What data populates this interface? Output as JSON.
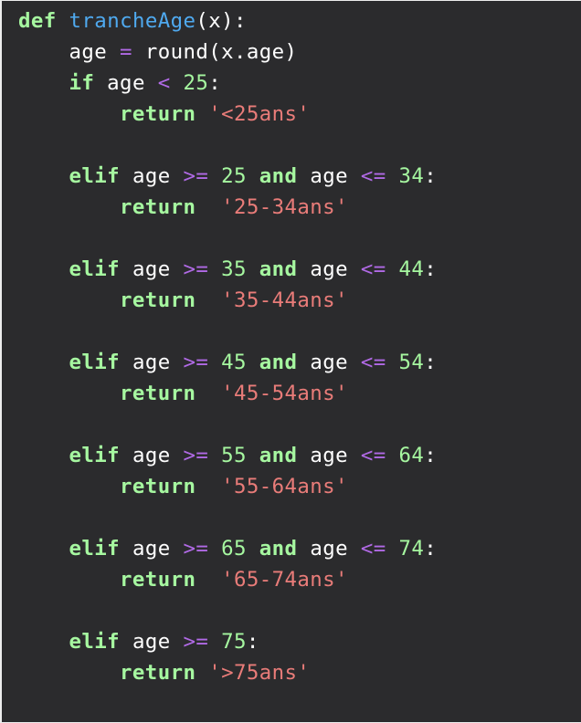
{
  "code": {
    "lines": [
      [
        {
          "text": "def",
          "kind": "kw"
        },
        {
          "text": " ",
          "kind": "txt"
        },
        {
          "text": "trancheAge",
          "kind": "fn"
        },
        {
          "text": "(x):",
          "kind": "txt"
        }
      ],
      [
        {
          "text": "    age ",
          "kind": "txt"
        },
        {
          "text": "=",
          "kind": "op"
        },
        {
          "text": " round(x.age)",
          "kind": "txt"
        }
      ],
      [
        {
          "text": "    ",
          "kind": "txt"
        },
        {
          "text": "if",
          "kind": "kw"
        },
        {
          "text": " age ",
          "kind": "txt"
        },
        {
          "text": "<",
          "kind": "op"
        },
        {
          "text": " ",
          "kind": "txt"
        },
        {
          "text": "25",
          "kind": "num"
        },
        {
          "text": ":",
          "kind": "txt"
        }
      ],
      [
        {
          "text": "        ",
          "kind": "txt"
        },
        {
          "text": "return",
          "kind": "kw"
        },
        {
          "text": " ",
          "kind": "txt"
        },
        {
          "text": "'<25ans'",
          "kind": "str"
        }
      ],
      [
        {
          "text": "",
          "kind": "txt"
        }
      ],
      [
        {
          "text": "    ",
          "kind": "txt"
        },
        {
          "text": "elif",
          "kind": "kw"
        },
        {
          "text": " age ",
          "kind": "txt"
        },
        {
          "text": ">=",
          "kind": "op"
        },
        {
          "text": " ",
          "kind": "txt"
        },
        {
          "text": "25",
          "kind": "num"
        },
        {
          "text": " ",
          "kind": "txt"
        },
        {
          "text": "and",
          "kind": "kw"
        },
        {
          "text": " age ",
          "kind": "txt"
        },
        {
          "text": "<=",
          "kind": "op"
        },
        {
          "text": " ",
          "kind": "txt"
        },
        {
          "text": "34",
          "kind": "num"
        },
        {
          "text": ":",
          "kind": "txt"
        }
      ],
      [
        {
          "text": "        ",
          "kind": "txt"
        },
        {
          "text": "return",
          "kind": "kw"
        },
        {
          "text": "  ",
          "kind": "txt"
        },
        {
          "text": "'25-34ans'",
          "kind": "str"
        }
      ],
      [
        {
          "text": "",
          "kind": "txt"
        }
      ],
      [
        {
          "text": "    ",
          "kind": "txt"
        },
        {
          "text": "elif",
          "kind": "kw"
        },
        {
          "text": " age ",
          "kind": "txt"
        },
        {
          "text": ">=",
          "kind": "op"
        },
        {
          "text": " ",
          "kind": "txt"
        },
        {
          "text": "35",
          "kind": "num"
        },
        {
          "text": " ",
          "kind": "txt"
        },
        {
          "text": "and",
          "kind": "kw"
        },
        {
          "text": " age ",
          "kind": "txt"
        },
        {
          "text": "<=",
          "kind": "op"
        },
        {
          "text": " ",
          "kind": "txt"
        },
        {
          "text": "44",
          "kind": "num"
        },
        {
          "text": ":",
          "kind": "txt"
        }
      ],
      [
        {
          "text": "        ",
          "kind": "txt"
        },
        {
          "text": "return",
          "kind": "kw"
        },
        {
          "text": "  ",
          "kind": "txt"
        },
        {
          "text": "'35-44ans'",
          "kind": "str"
        }
      ],
      [
        {
          "text": "",
          "kind": "txt"
        }
      ],
      [
        {
          "text": "    ",
          "kind": "txt"
        },
        {
          "text": "elif",
          "kind": "kw"
        },
        {
          "text": " age ",
          "kind": "txt"
        },
        {
          "text": ">=",
          "kind": "op"
        },
        {
          "text": " ",
          "kind": "txt"
        },
        {
          "text": "45",
          "kind": "num"
        },
        {
          "text": " ",
          "kind": "txt"
        },
        {
          "text": "and",
          "kind": "kw"
        },
        {
          "text": " age ",
          "kind": "txt"
        },
        {
          "text": "<=",
          "kind": "op"
        },
        {
          "text": " ",
          "kind": "txt"
        },
        {
          "text": "54",
          "kind": "num"
        },
        {
          "text": ":",
          "kind": "txt"
        }
      ],
      [
        {
          "text": "        ",
          "kind": "txt"
        },
        {
          "text": "return",
          "kind": "kw"
        },
        {
          "text": "  ",
          "kind": "txt"
        },
        {
          "text": "'45-54ans'",
          "kind": "str"
        }
      ],
      [
        {
          "text": "",
          "kind": "txt"
        }
      ],
      [
        {
          "text": "    ",
          "kind": "txt"
        },
        {
          "text": "elif",
          "kind": "kw"
        },
        {
          "text": " age ",
          "kind": "txt"
        },
        {
          "text": ">=",
          "kind": "op"
        },
        {
          "text": " ",
          "kind": "txt"
        },
        {
          "text": "55",
          "kind": "num"
        },
        {
          "text": " ",
          "kind": "txt"
        },
        {
          "text": "and",
          "kind": "kw"
        },
        {
          "text": " age ",
          "kind": "txt"
        },
        {
          "text": "<=",
          "kind": "op"
        },
        {
          "text": " ",
          "kind": "txt"
        },
        {
          "text": "64",
          "kind": "num"
        },
        {
          "text": ":",
          "kind": "txt"
        }
      ],
      [
        {
          "text": "        ",
          "kind": "txt"
        },
        {
          "text": "return",
          "kind": "kw"
        },
        {
          "text": "  ",
          "kind": "txt"
        },
        {
          "text": "'55-64ans'",
          "kind": "str"
        }
      ],
      [
        {
          "text": "",
          "kind": "txt"
        }
      ],
      [
        {
          "text": "    ",
          "kind": "txt"
        },
        {
          "text": "elif",
          "kind": "kw"
        },
        {
          "text": " age ",
          "kind": "txt"
        },
        {
          "text": ">=",
          "kind": "op"
        },
        {
          "text": " ",
          "kind": "txt"
        },
        {
          "text": "65",
          "kind": "num"
        },
        {
          "text": " ",
          "kind": "txt"
        },
        {
          "text": "and",
          "kind": "kw"
        },
        {
          "text": " age ",
          "kind": "txt"
        },
        {
          "text": "<=",
          "kind": "op"
        },
        {
          "text": " ",
          "kind": "txt"
        },
        {
          "text": "74",
          "kind": "num"
        },
        {
          "text": ":",
          "kind": "txt"
        }
      ],
      [
        {
          "text": "        ",
          "kind": "txt"
        },
        {
          "text": "return",
          "kind": "kw"
        },
        {
          "text": "  ",
          "kind": "txt"
        },
        {
          "text": "'65-74ans'",
          "kind": "str"
        }
      ],
      [
        {
          "text": "",
          "kind": "txt"
        }
      ],
      [
        {
          "text": "    ",
          "kind": "txt"
        },
        {
          "text": "elif",
          "kind": "kw"
        },
        {
          "text": " age ",
          "kind": "txt"
        },
        {
          "text": ">=",
          "kind": "op"
        },
        {
          "text": " ",
          "kind": "txt"
        },
        {
          "text": "75",
          "kind": "num"
        },
        {
          "text": ":",
          "kind": "txt"
        }
      ],
      [
        {
          "text": "        ",
          "kind": "txt"
        },
        {
          "text": "return",
          "kind": "kw"
        },
        {
          "text": " ",
          "kind": "txt"
        },
        {
          "text": "'>75ans'",
          "kind": "str"
        }
      ]
    ]
  },
  "colors": {
    "background": "#2b2b2d",
    "keyword": "#a6f7a0",
    "function_name": "#4fa9ef",
    "operator": "#b16ae6",
    "number": "#a6f7a0",
    "string": "#e97c79",
    "text": "#ffffff"
  }
}
